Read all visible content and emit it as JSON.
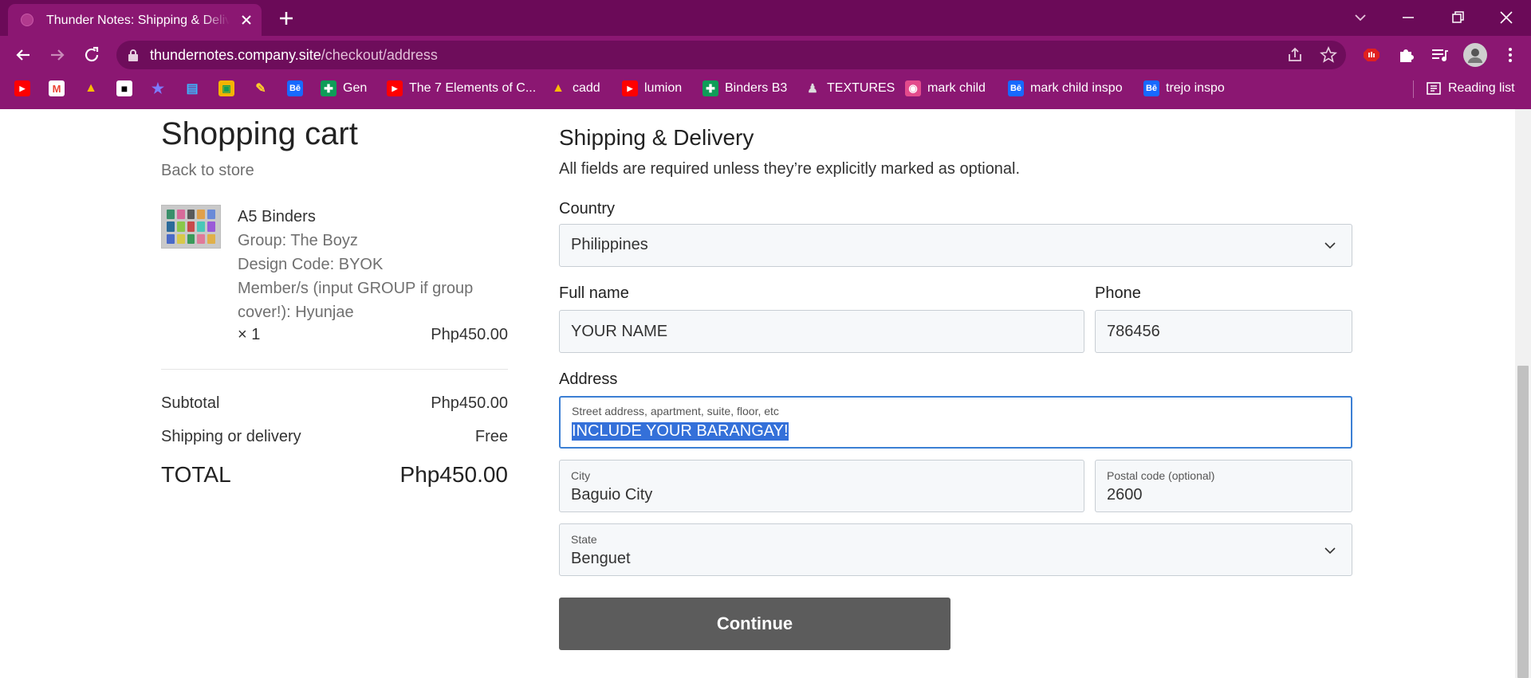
{
  "tab": {
    "title": "Thunder Notes: Shipping & Delivery"
  },
  "address_bar": {
    "host": "thundernotes.company.site",
    "path": "/checkout/address"
  },
  "bookmarks": [
    {
      "label": "",
      "icon": "youtube-icon",
      "color": "#ff0000",
      "glyph": "▶"
    },
    {
      "label": "",
      "icon": "gmail-icon",
      "color": "#ffffff",
      "glyph": "M"
    },
    {
      "label": "",
      "icon": "drive-icon",
      "color": "#fbbc04",
      "glyph": "▲"
    },
    {
      "label": "",
      "icon": "unsplash-icon",
      "color": "#000000",
      "glyph": "■"
    },
    {
      "label": "",
      "icon": "star-app-icon",
      "color": "#5b5bff",
      "glyph": "★"
    },
    {
      "label": "",
      "icon": "shop-icon",
      "color": "#2aa6ff",
      "glyph": "🛒"
    },
    {
      "label": "",
      "icon": "classroom-icon",
      "color": "#34a853",
      "glyph": "▣"
    },
    {
      "label": "",
      "icon": "feather-icon",
      "color": "#ffd02a",
      "glyph": "✎"
    },
    {
      "label": "",
      "icon": "behance-icon",
      "color": "#1769ff",
      "glyph": "Bē"
    },
    {
      "label": "Gen",
      "icon": "sheets-icon",
      "color": "#0f9d58",
      "glyph": "✚"
    },
    {
      "label": "The 7 Elements of C...",
      "icon": "youtube-icon",
      "color": "#ff0000",
      "glyph": "▶"
    },
    {
      "label": "cadd",
      "icon": "drive-icon",
      "color": "#fbbc04",
      "glyph": "▲"
    },
    {
      "label": "lumion",
      "icon": "youtube-icon",
      "color": "#ff0000",
      "glyph": "▶"
    },
    {
      "label": "Binders B3",
      "icon": "sheets-icon",
      "color": "#0f9d58",
      "glyph": "✚"
    },
    {
      "label": "TEXTURES",
      "icon": "person-icon",
      "color": "#333333",
      "glyph": "👤"
    },
    {
      "label": "mark child",
      "icon": "app-icon",
      "color": "#e34b8c",
      "glyph": "◉"
    },
    {
      "label": "mark child inspo",
      "icon": "behance-icon",
      "color": "#1769ff",
      "glyph": "Bē"
    },
    {
      "label": "trejo inspo",
      "icon": "behance-icon",
      "color": "#1769ff",
      "glyph": "Bē"
    }
  ],
  "reading_list": "Reading list",
  "cart": {
    "title": "Shopping cart",
    "back": "Back to store",
    "item": {
      "name": "A5 Binders",
      "lines": [
        "Group: The Boyz",
        "Design Code: BYOK",
        "Member/s (input GROUP if group",
        "cover!): Hyunjae"
      ],
      "qty": "× 1",
      "price": "Php450.00"
    },
    "subtotal_label": "Subtotal",
    "subtotal_value": "Php450.00",
    "shipping_label": "Shipping or delivery",
    "shipping_value": "Free",
    "total_label": "TOTAL",
    "total_value": "Php450.00"
  },
  "form": {
    "title": "Shipping & Delivery",
    "note": "All fields are required unless they’re explicitly marked as optional.",
    "country_label": "Country",
    "country_value": "Philippines",
    "fullname_label": "Full name",
    "fullname_value": "YOUR NAME",
    "phone_label": "Phone",
    "phone_value": "786456",
    "address_label": "Address",
    "street_placeholder": "Street address, apartment, suite, floor, etc",
    "street_value": "INCLUDE YOUR BARANGAY!",
    "city_label": "City",
    "city_value": "Baguio City",
    "postal_label": "Postal code (optional)",
    "postal_value": "2600",
    "state_label": "State",
    "state_value": "Benguet",
    "continue": "Continue"
  }
}
